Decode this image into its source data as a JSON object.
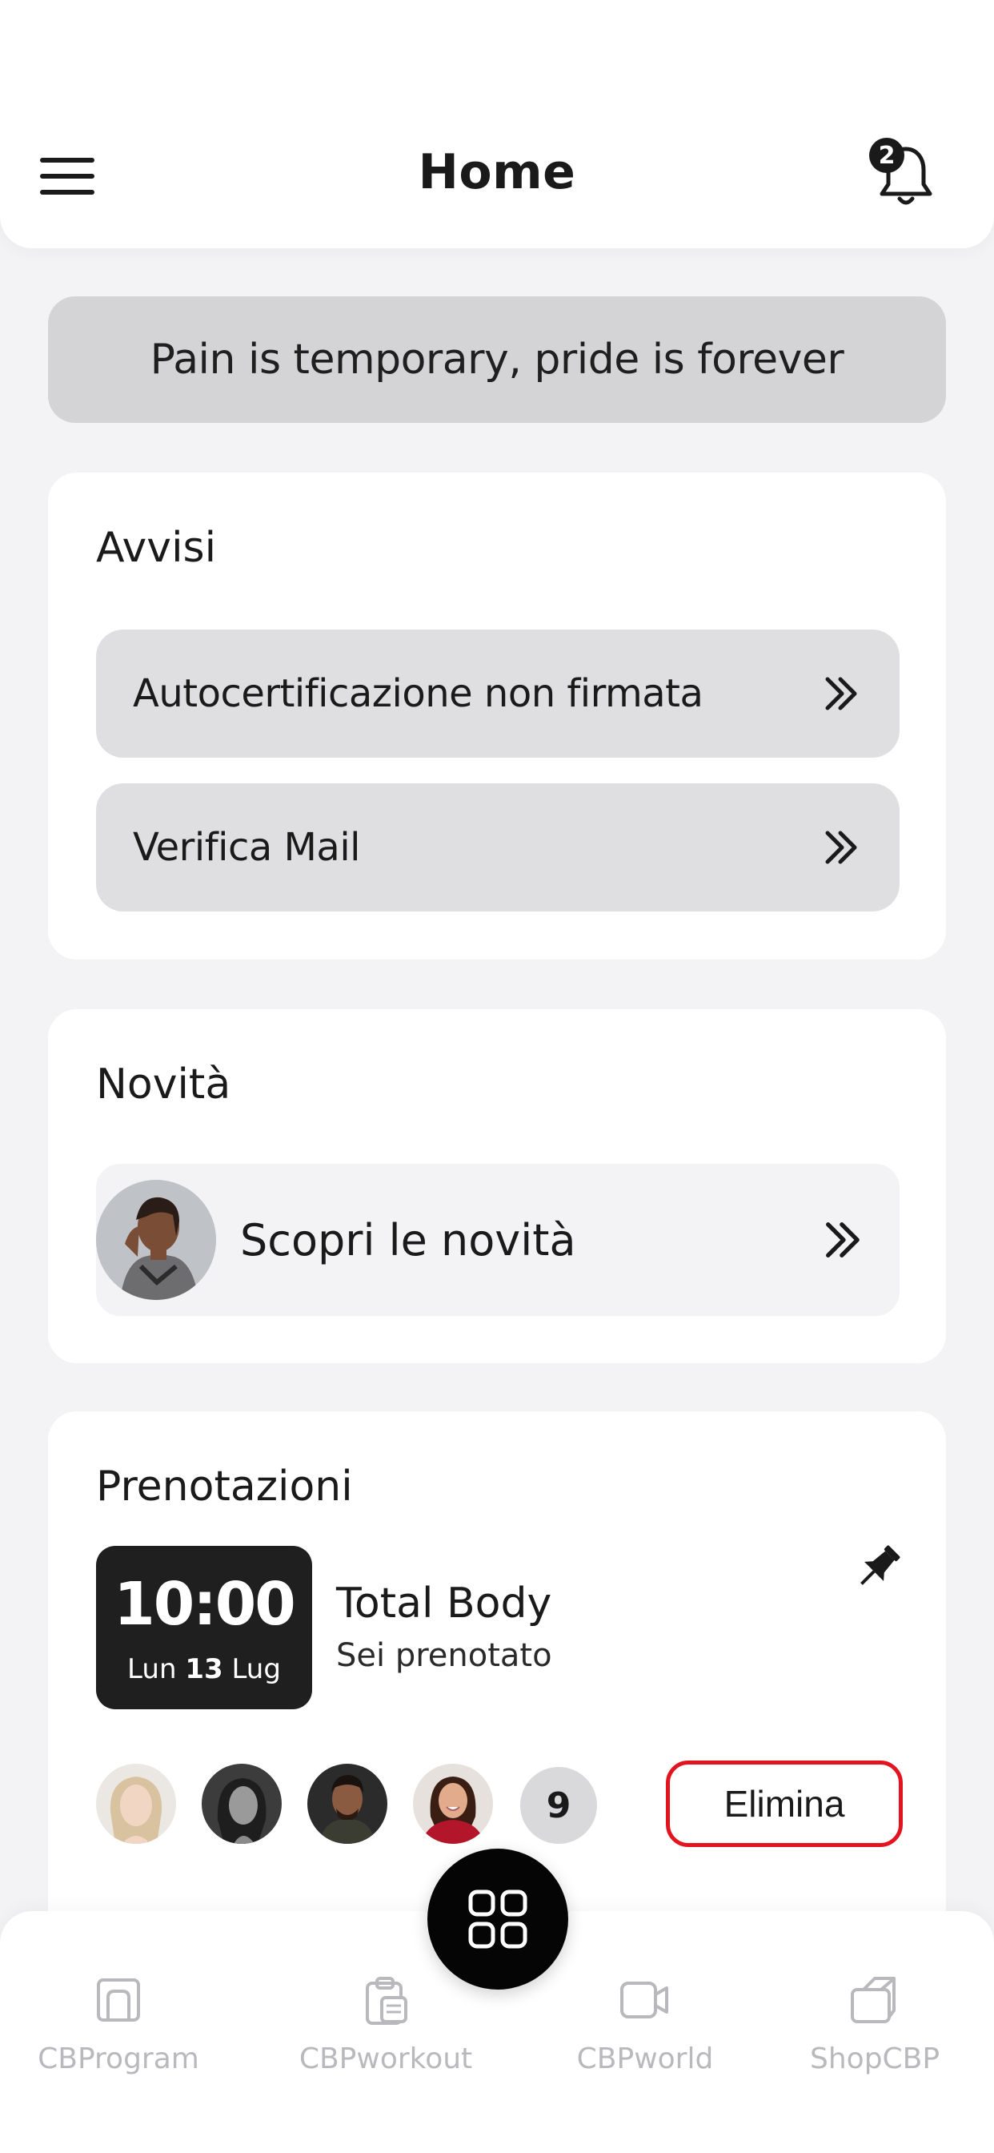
{
  "header": {
    "title": "Home",
    "notification_count": "2",
    "menu_icon": "hamburger-menu-icon",
    "bell_icon": "bell-icon"
  },
  "quote": {
    "text": "Pain is temporary, pride is forever"
  },
  "alerts": {
    "title": "Avvisi",
    "items": [
      {
        "label": "Autocertificazione non firmata",
        "icon": "double-chevron-right-icon"
      },
      {
        "label": "Verifica Mail",
        "icon": "double-chevron-right-icon"
      }
    ]
  },
  "news": {
    "title": "Novità",
    "item_label": "Scopri le novità",
    "icon": "double-chevron-right-icon"
  },
  "bookings": {
    "title": "Prenotazioni",
    "time": "10:00",
    "day_name": "Lun",
    "day_number": "13",
    "month": "Lug",
    "class_name": "Total Body",
    "status": "Sei prenotato",
    "pin_icon": "pin-icon",
    "extra_attendees": "9",
    "delete_label": "Elimina",
    "delete_color": "#e3141f"
  },
  "bottom_nav": {
    "items": [
      {
        "label": "CBProgram",
        "icon": "program-icon"
      },
      {
        "label": "CBPworkout",
        "icon": "clipboard-icon"
      },
      {
        "label": "CBPworld",
        "icon": "video-camera-icon"
      },
      {
        "label": "ShopCBP",
        "icon": "shopping-bag-icon"
      }
    ],
    "fab_icon": "grid-icon"
  }
}
